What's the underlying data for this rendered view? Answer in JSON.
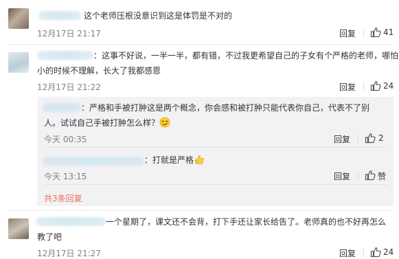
{
  "comments": [
    {
      "text": "这个老师压根没意识到这是体罚是不对的",
      "time": "12月17日 21:17",
      "reply_label": "回复",
      "likes": "41"
    },
    {
      "text_line1": "：这事不好说，一半一半，都有错，不过我更希望自己的子女有个严格的老师，哪怕",
      "text_line2": "小的时候不理解，长大了我都感恩",
      "time": "12月17日 21:22",
      "reply_label": "回复",
      "likes": "24",
      "replies": [
        {
          "text_line1": "：严格和手被打肿这是两个概念，你会感和被打肿只能代表你自己，代表不了别",
          "text_line2": "人。试试自己手被打肿怎么样？",
          "emoji": "smirk-emoji",
          "time": "今天 00:35",
          "reply_label": "回复",
          "likes": "2"
        },
        {
          "text": "：打就是严格",
          "emoji": "thumbs-up-emoji",
          "time": "今天 13:15",
          "reply_label": "回复",
          "likes": "赞"
        }
      ],
      "more_replies": "共3条回复"
    },
    {
      "text_line1": "一个星期了，课文还不会背，打下手还让家长给告了。老师真的也不好再怎么",
      "text_line2": "教了吧",
      "time": "12月17日 21:27",
      "reply_label": "回复",
      "likes": "24"
    }
  ],
  "colors": {
    "link": "#eb7350",
    "muted": "#808080",
    "reply_bg": "#f2f2f5"
  }
}
